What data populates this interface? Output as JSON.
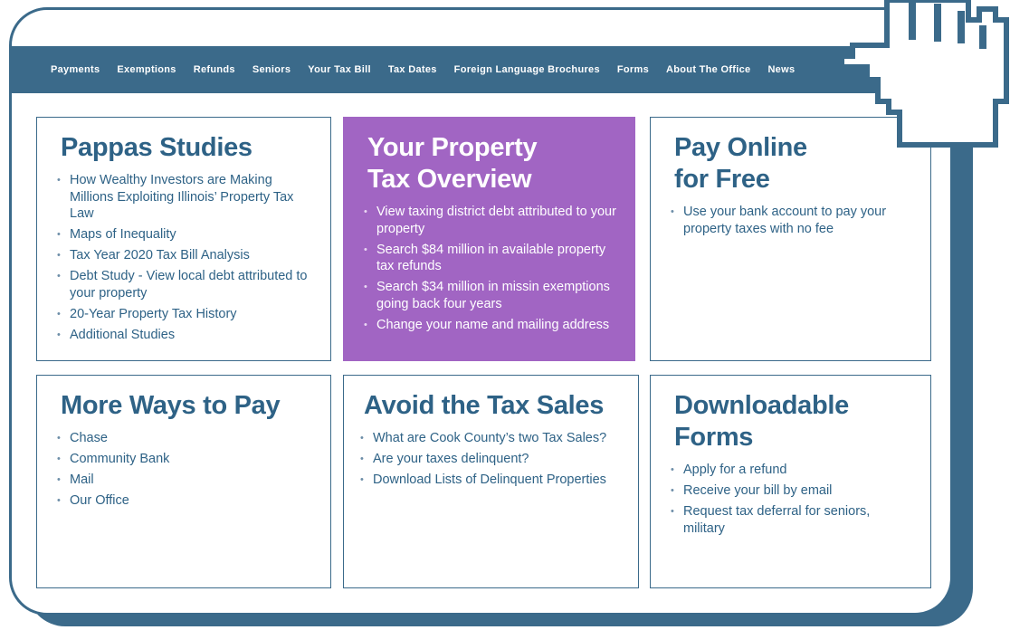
{
  "nav": {
    "items": [
      "Payments",
      "Exemptions",
      "Refunds",
      "Seniors",
      "Your Tax Bill",
      "Tax Dates",
      "Foreign Language Brochures",
      "Forms",
      "About The Office",
      "News"
    ]
  },
  "cards": {
    "pappas": {
      "title": "Pappas Studies",
      "items": [
        "How Wealthy Investors are Making Millions Exploiting Illinois’ Property Tax Law",
        "Maps of Inequality",
        "Tax Year 2020 Tax Bill Analysis",
        "Debt Study - View local debt attributed to your property",
        "20-Year Property Tax History",
        "Additional Studies"
      ]
    },
    "overview": {
      "title_line1": "Your Property",
      "title_line2": "Tax Overview",
      "items": [
        "View taxing district debt attributed to your property",
        "Search $84 million in available property tax refunds",
        "Search $34 million in missin exemptions going back four years",
        "Change your name and mailing address"
      ]
    },
    "payonline": {
      "title_line1": "Pay Online",
      "title_line2": "for Free",
      "items": [
        "Use your bank account to pay your property taxes with no fee"
      ]
    },
    "moreways": {
      "title": "More Ways to Pay",
      "items": [
        "Chase",
        "Community Bank",
        "Mail",
        "Our Office"
      ]
    },
    "taxsales": {
      "title": "Avoid the Tax Sales",
      "items": [
        "What are Cook County’s two Tax Sales?",
        "Are your taxes delinquent?",
        "Download Lists of Delinquent Properties"
      ]
    },
    "forms": {
      "title_line1": "Downloadable",
      "title_line2": "Forms",
      "items": [
        "Apply for a refund",
        "Receive your bill by email",
        "Request tax deferral for seniors, military"
      ]
    }
  },
  "colors": {
    "primary": "#3b6a8a",
    "heading": "#2e6286",
    "featured": "#a165c3"
  },
  "icons": {
    "cursor": "pointer-hand-icon"
  }
}
